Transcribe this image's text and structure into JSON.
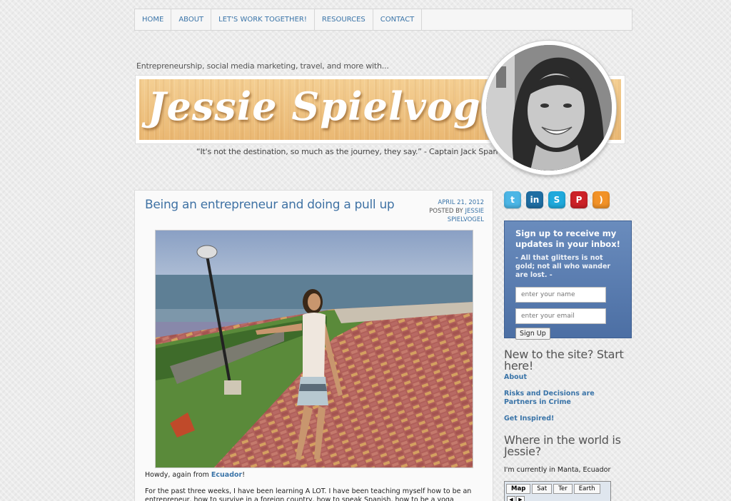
{
  "nav": {
    "items": [
      "HOME",
      "ABOUT",
      "LET'S WORK TOGETHER!",
      "RESOURCES",
      "CONTACT"
    ]
  },
  "header": {
    "tagline": "Entrepreneurship, social media marketing, travel, and more with...",
    "site_name": "Jessie Spielvogel",
    "quote": "“It's not the destination, so much as the journey, they say.” - Captain Jack Sparrow"
  },
  "post": {
    "title": "Being an entrepreneur and doing a pull up",
    "date": "APRIL 21, 2012",
    "posted_by_label": "POSTED BY",
    "author": "JESSIE SPIELVOGEL",
    "p1_text": "Howdy, again from",
    "p1_link": "Ecuador",
    "p1_end": "!",
    "p2_text": "For the past three weeks, I have been learning A LOT. I have been teaching myself how to be an entrepreneur, how to survive in a foreign country, how to speak Spanish, how to be a yoga instructor, how to do a pull up,"
  },
  "social": {
    "icons": [
      {
        "name": "twitter-icon",
        "glyph": "t",
        "color": "#4cb6e6"
      },
      {
        "name": "linkedin-icon",
        "glyph": "in",
        "color": "#1f6ea3"
      },
      {
        "name": "skype-icon",
        "glyph": "S",
        "color": "#1fa9dc"
      },
      {
        "name": "pinterest-icon",
        "glyph": "P",
        "color": "#cc2127"
      },
      {
        "name": "rss-icon",
        "glyph": ")",
        "color": "#f29227"
      }
    ]
  },
  "signup": {
    "title": "Sign up to receive my updates in your inbox!",
    "subtitle": "- All that glitters is not gold; not all who wander are lost. -",
    "name_placeholder": "enter your name",
    "email_placeholder": "enter your email",
    "button": "Sign Up"
  },
  "sidebar": {
    "start_heading": "New to the site? Start here!",
    "links": [
      "About",
      "Risks and Decisions are Partners in Crime",
      "Get Inspired!"
    ],
    "where_heading": "Where in the world is Jessie?",
    "location_text": "I'm currently in Manta, Ecuador",
    "map_tabs": [
      "Map",
      "Sat",
      "Ter",
      "Earth"
    ]
  }
}
